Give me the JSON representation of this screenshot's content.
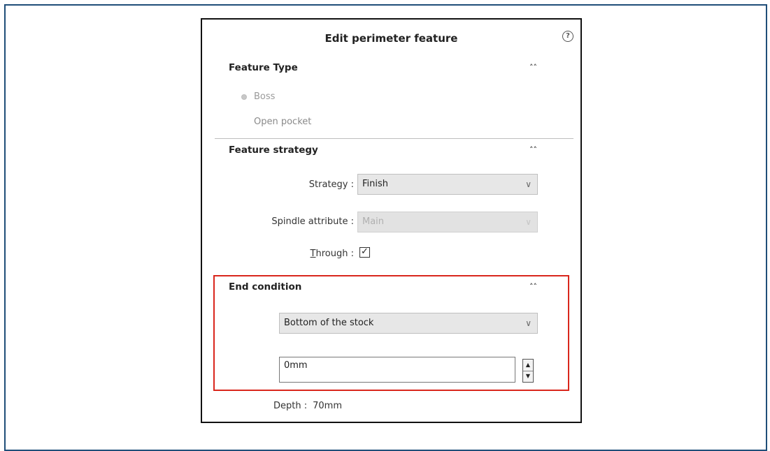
{
  "dialog": {
    "title": "Edit perimeter feature",
    "help_icon": "help-circle-icon"
  },
  "feature_type": {
    "header": "Feature Type",
    "options": [
      "Boss",
      "Open pocket"
    ]
  },
  "feature_strategy": {
    "header": "Feature strategy",
    "strategy_label": "Strategy :",
    "strategy_value": "Finish",
    "spindle_label": "Spindle attribute :",
    "spindle_value": "Main",
    "through_label_prefix": "T",
    "through_label_rest": "hrough :",
    "through_checked": true
  },
  "end_condition": {
    "header": "End condition",
    "type_value": "Bottom of the stock",
    "offset_value": "0mm"
  },
  "depth": {
    "label": "Depth :",
    "value": "70mm"
  },
  "colors": {
    "highlight_border": "#d9261c",
    "outer_frame": "#1f4e79"
  }
}
